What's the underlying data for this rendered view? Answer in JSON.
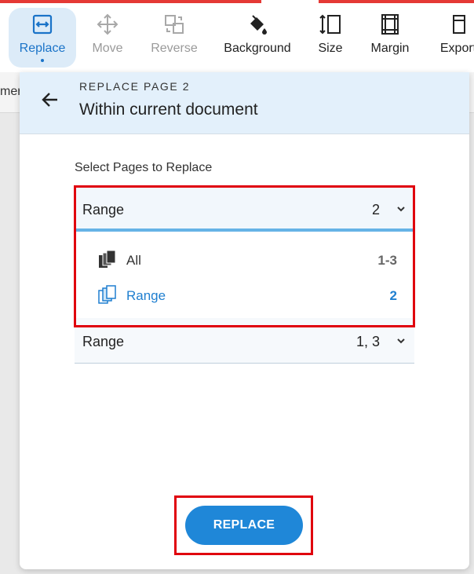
{
  "toolbar": {
    "items": [
      {
        "label": "Replace",
        "icon": "swap-box-icon",
        "state": "active"
      },
      {
        "label": "Move",
        "icon": "move-arrows-icon",
        "state": "disabled"
      },
      {
        "label": "Reverse",
        "icon": "reverse-pages-icon",
        "state": "disabled"
      },
      {
        "label": "Background",
        "icon": "paint-bucket-icon",
        "state": "normal"
      },
      {
        "label": "Size",
        "icon": "page-size-icon",
        "state": "normal"
      },
      {
        "label": "Margin",
        "icon": "margin-icon",
        "state": "normal"
      },
      {
        "label": "Export",
        "icon": "export-icon",
        "state": "normal"
      }
    ]
  },
  "background": {
    "partial_text": "mer"
  },
  "panel": {
    "overline": "REPLACE PAGE 2",
    "title": "Within current document",
    "section_label": "Select Pages to Replace",
    "open_select": {
      "label": "Range",
      "value": "2"
    },
    "options": [
      {
        "label": "All",
        "value": "1-3",
        "icon": "pages-stack-icon",
        "selected": false
      },
      {
        "label": "Range",
        "value": "2",
        "icon": "pages-stack-icon",
        "selected": true
      }
    ],
    "second_select": {
      "label": "Range",
      "value": "1, 3"
    },
    "replace_button": "REPLACE"
  },
  "colors": {
    "accent": "#1f87d8",
    "highlight": "#e0000d",
    "header_bg": "#e3f0fb"
  }
}
